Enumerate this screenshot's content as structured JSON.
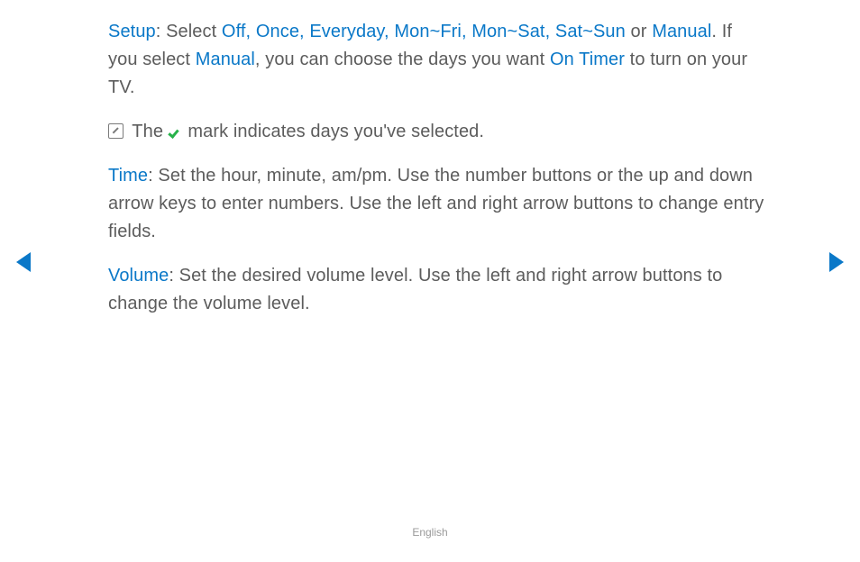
{
  "setup": {
    "label": "Setup",
    "lead": ": Select ",
    "options": "Off, Once, Everyday, Mon~Fri, Mon~Sat, Sat~Sun",
    "or": " or ",
    "manual": "Manual",
    "period": ".",
    "line2a": "If you select ",
    "line2b": ", you can choose the days you want ",
    "ontimer": "On Timer",
    "line2c": " to turn on your TV."
  },
  "note": {
    "pre": " The ",
    "post": " mark indicates days you've selected."
  },
  "time": {
    "label": "Time",
    "text": ": Set the hour, minute, am/pm. Use the number buttons or the up and down arrow keys to enter numbers. Use the left and right arrow buttons to change entry fields."
  },
  "volume": {
    "label": "Volume",
    "text": ": Set the desired volume level. Use the left and right arrow buttons to change the volume level."
  },
  "footer": "English"
}
